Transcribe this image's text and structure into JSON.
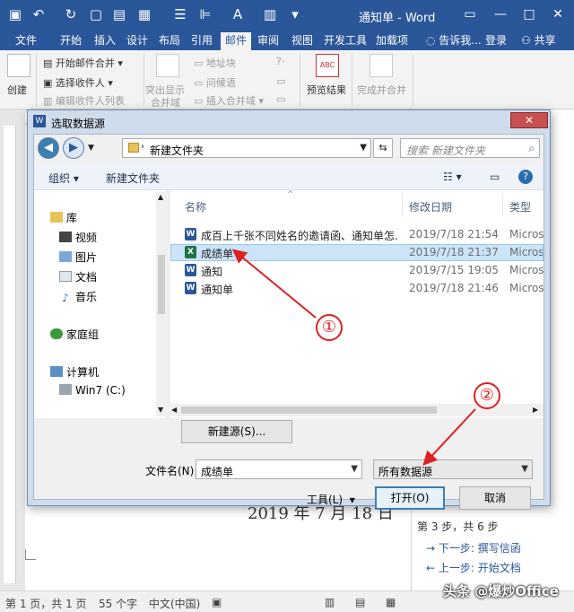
{
  "titlebar": {
    "title": "通知单 - Word",
    "qat": [
      "save-icon",
      "undo-icon",
      "redo-icon",
      "new-icon",
      "open-icon",
      "print-icon",
      "list-icon",
      "align-icon",
      "font-color-icon",
      "spell-icon",
      "customize-icon"
    ]
  },
  "tabs": [
    {
      "label": "文件"
    },
    {
      "label": "开始"
    },
    {
      "label": "插入"
    },
    {
      "label": "设计"
    },
    {
      "label": "布局"
    },
    {
      "label": "引用"
    },
    {
      "label": "邮件"
    },
    {
      "label": "审阅"
    },
    {
      "label": "视图"
    },
    {
      "label": "开发工具"
    },
    {
      "label": "加载项"
    }
  ],
  "tellme": "告诉我...",
  "login": "登录",
  "share": "共享",
  "ribbon": {
    "create": "创建",
    "start_merge": "开始邮件合并",
    "select_recipients": "选择收件人",
    "edit_recipients": "编辑收件人列表",
    "highlight_merge": "突出显示",
    "highlight_merge2": "合并域",
    "address_block": "地址块",
    "greeting": "问候语",
    "insert_merge": "插入合并域",
    "preview": "预览结果",
    "finish_merge": "完成并合并"
  },
  "dialog": {
    "title": "选取数据源",
    "address": "新建文件夹",
    "search_placeholder": "搜索 新建文件夹",
    "organize": "组织",
    "new_folder": "新建文件夹",
    "nav": {
      "library": "库",
      "video": "视频",
      "pictures": "图片",
      "documents": "文档",
      "music": "音乐",
      "homegroup": "家庭组",
      "computer": "计算机",
      "drive": "Win7 (C:)"
    },
    "columns": {
      "name": "名称",
      "date": "修改日期",
      "type": "类型"
    },
    "files": [
      {
        "name": "成百上千张不同姓名的邀请函、通知单怎...",
        "date": "2019/7/18 21:54",
        "type": "Microso",
        "kind": "W"
      },
      {
        "name": "成绩单",
        "date": "2019/7/18 21:37",
        "type": "Microso",
        "kind": "X"
      },
      {
        "name": "通知",
        "date": "2019/7/15 19:05",
        "type": "Microso",
        "kind": "W"
      },
      {
        "name": "通知单",
        "date": "2019/7/18 21:46",
        "type": "Microso",
        "kind": "W"
      }
    ],
    "new_source_button": "新建源(S)...",
    "filename_label": "文件名(N):",
    "filename_value": "成绩单",
    "filter_value": "所有数据源",
    "tools": "工具(L)",
    "open_button": "打开(O)",
    "cancel_button": "取消"
  },
  "document": {
    "date_text": "2019 年 7 月 18 日"
  },
  "right_pane": {
    "step": "第 3 步，共 6 步",
    "next": "下一步: 撰写信函",
    "prev": "上一步: 开始文档"
  },
  "status": {
    "page": "第 1 页，共 1 页",
    "words": "55 个字",
    "lang": "中文(中国)"
  },
  "annotations": {
    "one": "①",
    "two": "②"
  },
  "watermark": "头条 @爆炒Office",
  "colors": {
    "word_blue": "#2b579a",
    "annotation_red": "#e02020",
    "excel_green": "#1f7244"
  }
}
